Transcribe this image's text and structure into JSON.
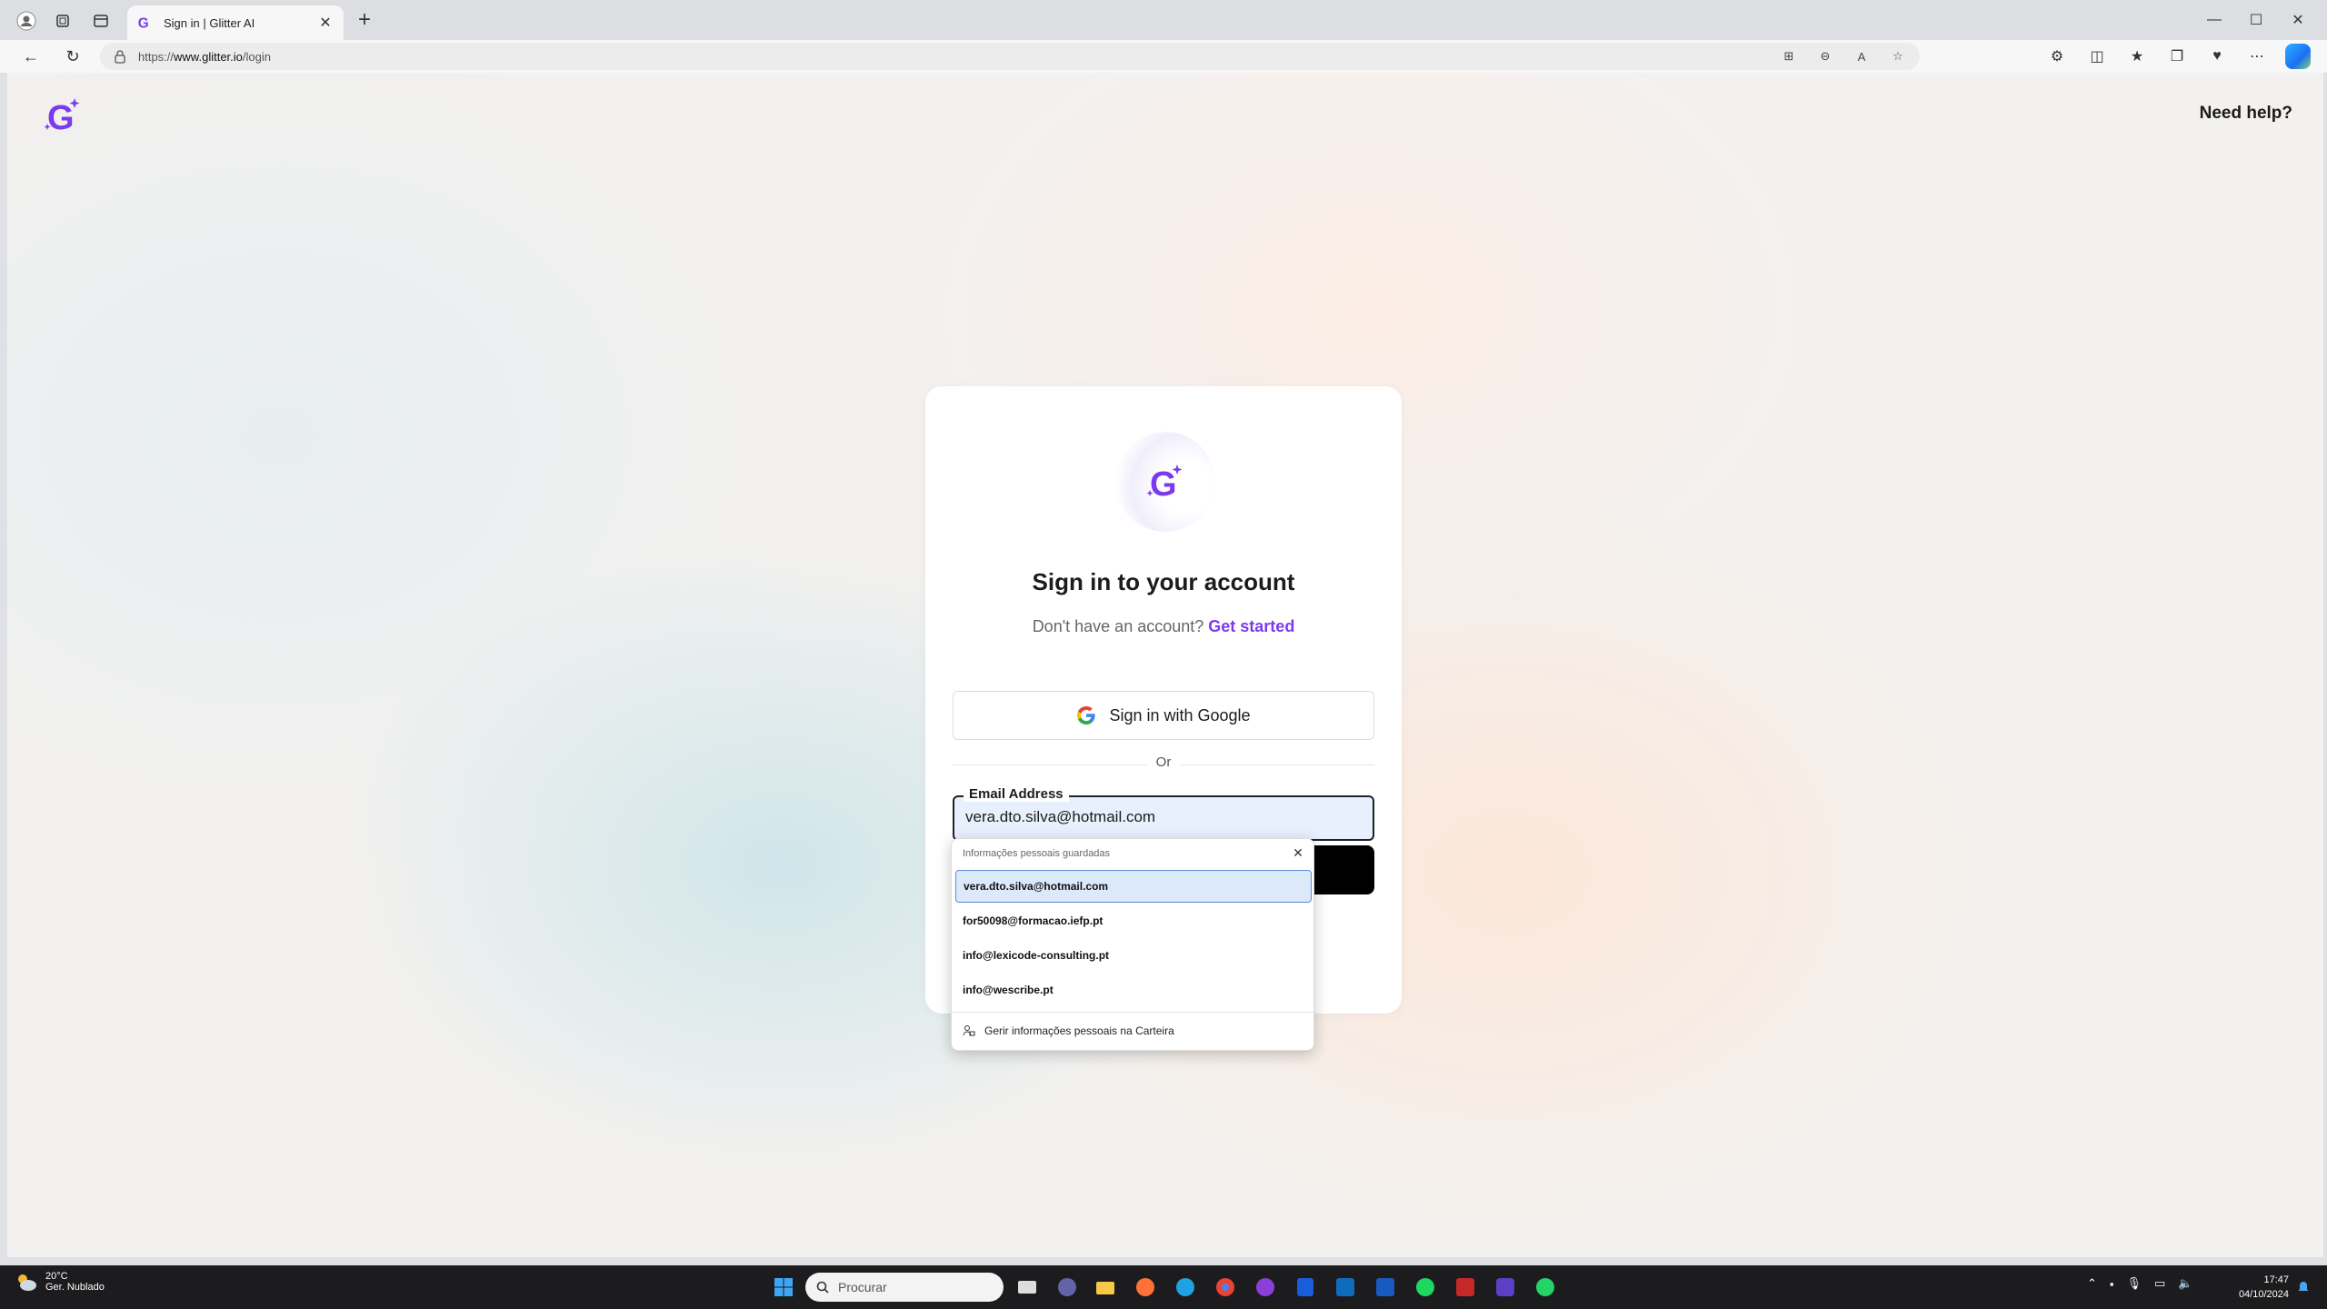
{
  "browser": {
    "tab_title": "Sign in | Glitter AI",
    "url_prefix": "https://",
    "url_host": "www.glitter.io",
    "url_path": "/login"
  },
  "page": {
    "need_help": "Need help?",
    "title": "Sign in to your account",
    "no_account_text": "Don't have an account?",
    "get_started": "Get started",
    "google_button": "Sign in with Google",
    "divider": "Or",
    "email_label": "Email Address",
    "email_value": "vera.dto.silva@hotmail.com"
  },
  "autofill": {
    "header": "Informações pessoais guardadas",
    "items": [
      "vera.dto.silva@hotmail.com",
      "for50098@formacao.iefp.pt",
      "info@lexicode-consulting.pt",
      "info@wescribe.pt"
    ],
    "footer": "Gerir informações pessoais na Carteira"
  },
  "taskbar": {
    "temperature": "20°C",
    "weather": "Ger. Nublado",
    "search_placeholder": "Procurar",
    "time": "17:47",
    "date": "04/10/2024"
  },
  "colors": {
    "accent": "#7c3aed",
    "button": "#000000"
  }
}
